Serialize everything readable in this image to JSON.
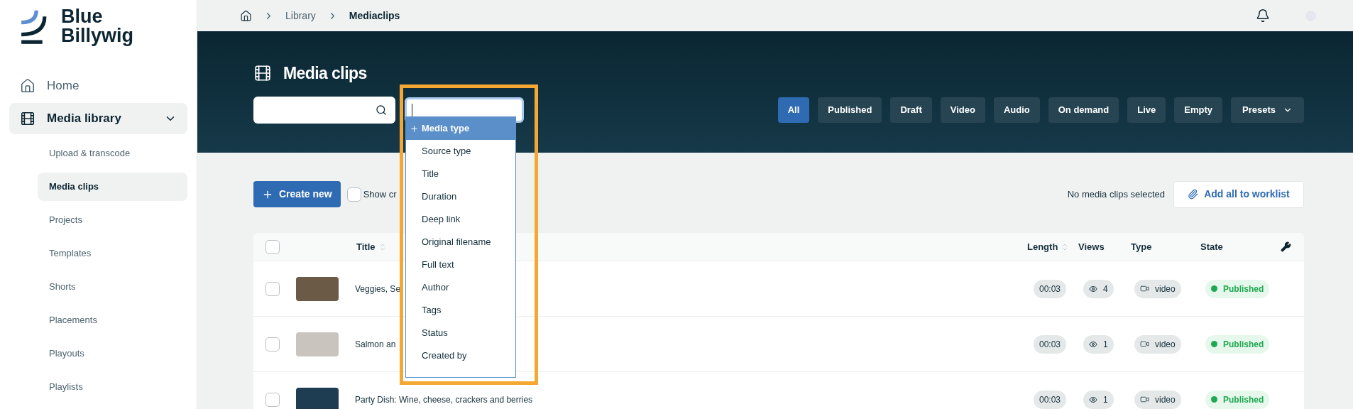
{
  "logo": {
    "line1": "Blue",
    "line2": "Billywig"
  },
  "nav": [
    {
      "label": "Home",
      "kind": "home"
    },
    {
      "label": "Media library",
      "kind": "media",
      "expanded": true,
      "children": [
        {
          "label": "Upload & transcode",
          "selected": false
        },
        {
          "label": "Media clips",
          "selected": true
        },
        {
          "label": "Projects",
          "selected": false
        },
        {
          "label": "Templates",
          "selected": false
        },
        {
          "label": "Shorts",
          "selected": false
        },
        {
          "label": "Placements",
          "selected": false
        },
        {
          "label": "Playouts",
          "selected": false
        },
        {
          "label": "Playlists",
          "selected": false
        }
      ]
    }
  ],
  "breadcrumb": [
    "Library",
    "Mediaclips"
  ],
  "page_title": "Media clips",
  "filter_menu": {
    "items": [
      {
        "label": "Media type",
        "selected": true
      },
      {
        "label": "Source type",
        "selected": false
      },
      {
        "label": "Title",
        "selected": false
      },
      {
        "label": "Duration",
        "selected": false
      },
      {
        "label": "Deep link",
        "selected": false
      },
      {
        "label": "Original filename",
        "selected": false
      },
      {
        "label": "Full text",
        "selected": false
      },
      {
        "label": "Author",
        "selected": false
      },
      {
        "label": "Tags",
        "selected": false
      },
      {
        "label": "Status",
        "selected": false
      },
      {
        "label": "Created by",
        "selected": false
      }
    ]
  },
  "filters": [
    {
      "label": "All",
      "selected": true
    },
    {
      "label": "Published",
      "selected": false
    },
    {
      "label": "Draft",
      "selected": false
    },
    {
      "label": "Video",
      "selected": false
    },
    {
      "label": "Audio",
      "selected": false
    },
    {
      "label": "On demand",
      "selected": false
    },
    {
      "label": "Live",
      "selected": false
    },
    {
      "label": "Empty",
      "selected": false
    }
  ],
  "presets": "Presets",
  "create_button": "Create new",
  "show_checkbox": {
    "label": "Show cr",
    "checked": false
  },
  "selection_text": "No media clips selected",
  "worklist_button": "Add all to worklist",
  "table": {
    "header_checked": false,
    "columns": [
      {
        "label": "Title",
        "sortable": true
      },
      {
        "label": "Length",
        "sortable": true
      },
      {
        "label": "Views",
        "sortable": false
      },
      {
        "label": "Type",
        "sortable": false
      },
      {
        "label": "State",
        "sortable": false
      }
    ],
    "rows": [
      {
        "title": "Veggies, Se",
        "checked": false,
        "length": "00:03",
        "views": "4",
        "type": "video",
        "state": "Published"
      },
      {
        "title": "Salmon an",
        "checked": false,
        "length": "00:03",
        "views": "1",
        "type": "video",
        "state": "Published"
      },
      {
        "title": "Party Dish: Wine, cheese, crackers and berries",
        "checked": false,
        "length": "00:03",
        "views": "1",
        "type": "video",
        "state": "Published"
      }
    ]
  }
}
